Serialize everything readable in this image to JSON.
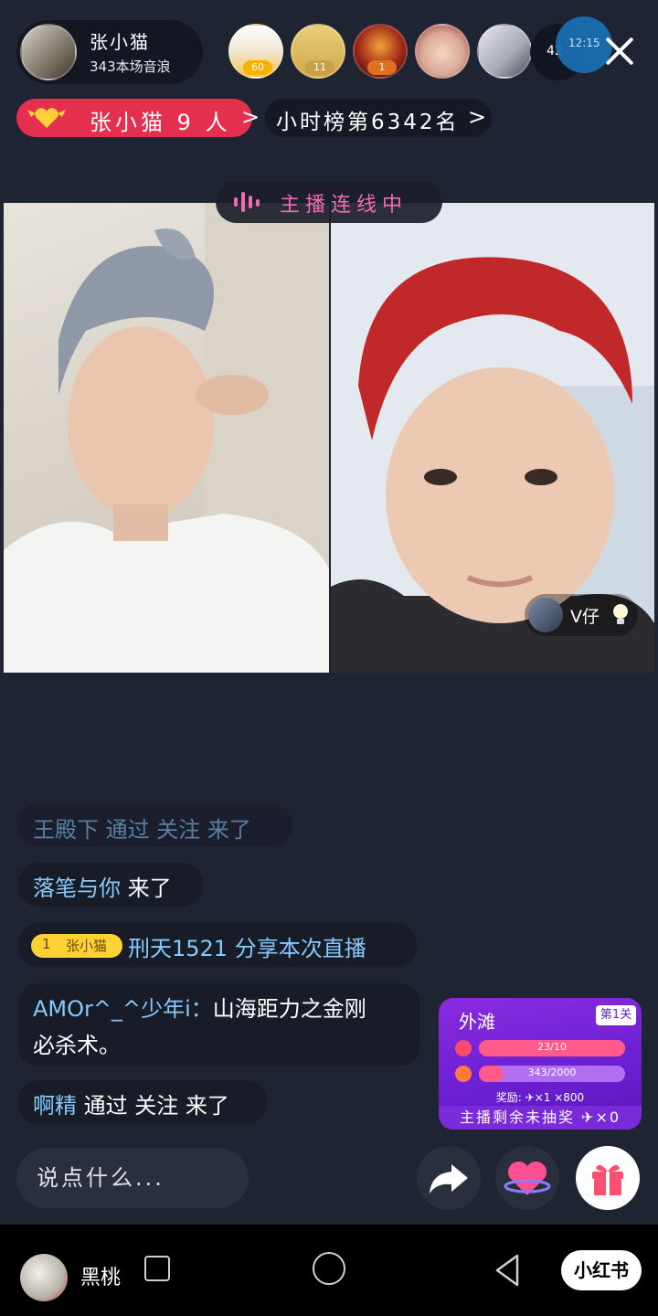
{
  "host": {
    "name": "张小猫",
    "subtitle": "343本场音浪"
  },
  "viewers": {
    "count": "42",
    "badges": [
      "60",
      "11",
      "1"
    ]
  },
  "time_bubble": "12:15",
  "fan_club": {
    "label": "张小猫 9 人",
    "chevron": ">"
  },
  "hour_rank": {
    "label": "小时榜第6342名",
    "chevron": ">"
  },
  "connect_status": "主播连线中",
  "guest": {
    "name": "V仔"
  },
  "chat": [
    {
      "user": "王殿下",
      "text": " 通过 关注 来了"
    },
    {
      "user": "落笔与你",
      "text": " 来了"
    },
    {
      "level": "1",
      "fan_tag": "张小猫",
      "user": "刑天1521",
      "text": " 分享本次直播"
    },
    {
      "user": "AMOr^_^少年i：",
      "text": "山海距力之金刚",
      "text2": "必杀术。"
    },
    {
      "user": "啊精",
      "text": " 通过 关注 来了"
    }
  ],
  "activity_card": {
    "title": "外滩",
    "stage": "第1关",
    "progress1": {
      "label": "23/10",
      "fraction": 1.0
    },
    "progress2": {
      "label": "343/2000",
      "fraction": 0.17
    },
    "reward": "奖励: ✈×1  ×800",
    "footer": "主播剩余未抽奖 ✈×0",
    "colors": {
      "bg": "#6a1fd0",
      "fill": "#ff5a8a"
    }
  },
  "input": {
    "placeholder": "说点什么..."
  },
  "system_bar": {
    "user_name": "黑桃",
    "brand": "小红书"
  },
  "colors": {
    "accent_red": "#e52f4f",
    "accent_pink": "#f36ab6",
    "chat_user": "#85c9ff",
    "background": "#1f2433"
  }
}
